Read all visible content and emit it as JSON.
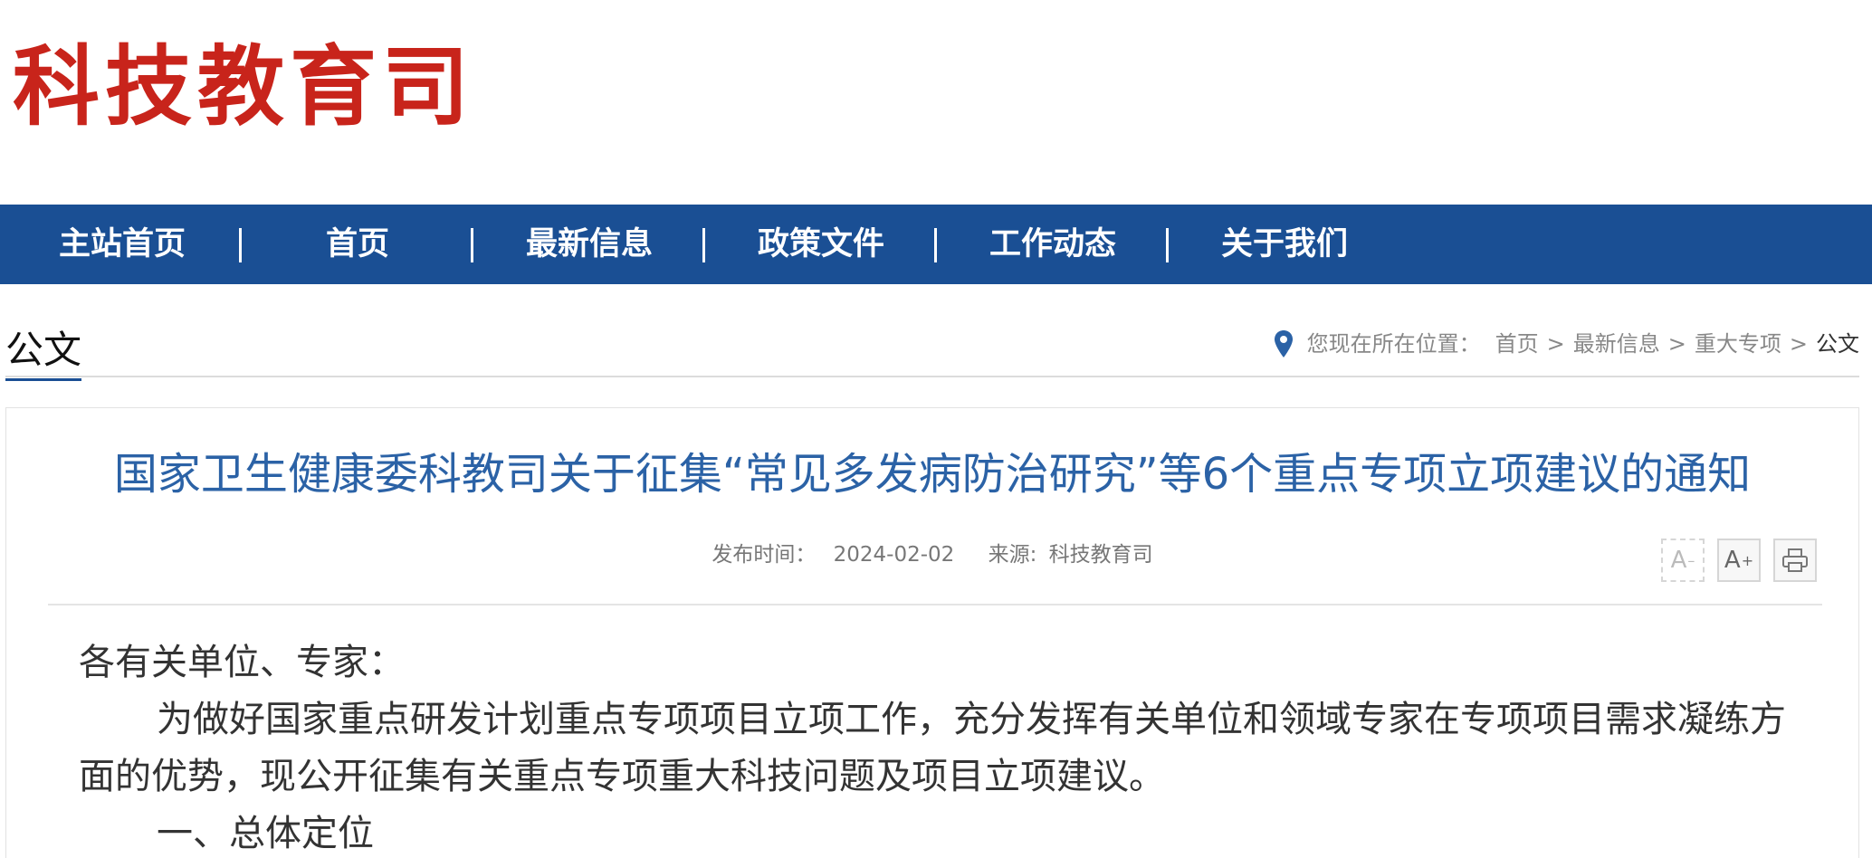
{
  "site": {
    "logo": "科技教育司"
  },
  "nav": [
    {
      "label": "主站首页"
    },
    {
      "label": "首页"
    },
    {
      "label": "最新信息"
    },
    {
      "label": "政策文件"
    },
    {
      "label": "工作动态"
    },
    {
      "label": "关于我们"
    }
  ],
  "section": {
    "title": "公文"
  },
  "breadcrumb": {
    "prefix": "您现在所在位置：",
    "items": [
      "首页",
      "最新信息",
      "重大专项"
    ],
    "current": "公文",
    "separator": ">"
  },
  "article": {
    "title": "国家卫生健康委科教司关于征集“常见多发病防治研究”等6个重点专项立项建议的通知",
    "publish_label": "发布时间：",
    "publish_date": "2024-02-02",
    "source_label": "来源:",
    "source": "科技教育司",
    "tools": {
      "decrease": "A",
      "increase": "A",
      "increase_sup": "+"
    },
    "salutation": "各有关单位、专家：",
    "paragraph1": "为做好国家重点研发计划重点专项项目立项工作，充分发挥有关单位和领域专家在专项项目需求凝练方面的优势，现公开征集有关重点专项重大科技问题及项目立项建议。",
    "heading1": "一、总体定位"
  },
  "colors": {
    "brand_red": "#c8241b",
    "nav_blue": "#1a4f94",
    "title_blue": "#2b62a6"
  }
}
